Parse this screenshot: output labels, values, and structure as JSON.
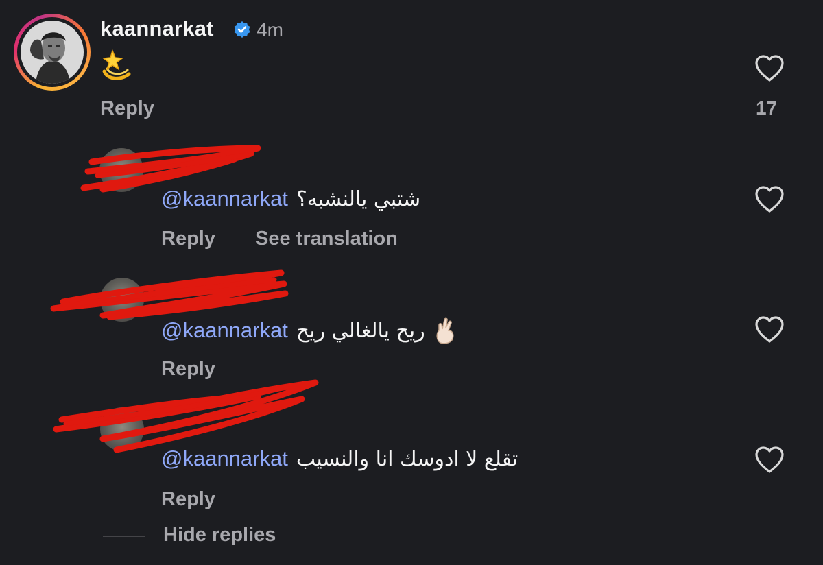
{
  "main_comment": {
    "username": "kaannarkat",
    "verified_icon": "verified-badge-icon",
    "time": "4m",
    "emoji": "💫",
    "reply_label": "Reply",
    "like_count": "17"
  },
  "replies": [
    {
      "username": "",
      "time": "",
      "mention": "@kaannarkat",
      "text": "شتبي يالنشبه؟",
      "reply_label": "Reply",
      "translation_label": "See translation"
    },
    {
      "username": "",
      "time": "",
      "mention": "@kaannarkat",
      "text": "ريح يالغالي ريح",
      "emoji": "🤞🏻",
      "reply_label": "Reply"
    },
    {
      "username": "",
      "time": "",
      "mention": "@kaannarkat",
      "text": "تقلع لا ادوسك انا والنسيب",
      "reply_label": "Reply"
    }
  ],
  "hide_replies_label": "Hide replies",
  "colors": {
    "background": "#1c1d21",
    "mention": "#8fa8f8",
    "muted": "#a8a8ad",
    "redaction": "#e0190f",
    "verified": "#3897f0"
  }
}
